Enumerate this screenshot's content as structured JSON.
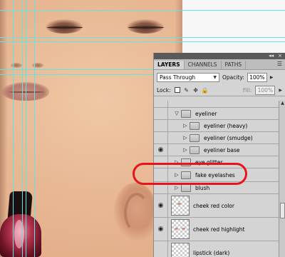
{
  "panel": {
    "topbar_buttons": [
      "◂◂",
      "×"
    ],
    "tabs": [
      {
        "label": "LAYERS",
        "active": true
      },
      {
        "label": "CHANNELS",
        "active": false
      },
      {
        "label": "PATHS",
        "active": false
      }
    ],
    "blend_mode": "Pass Through",
    "opacity_label": "Opacity:",
    "opacity_value": "100%",
    "lock_label": "Lock:",
    "fill_label": "Fill:",
    "fill_value": "100%"
  },
  "layers": [
    {
      "name": "eyeliner",
      "type": "group",
      "expanded": true,
      "indent": 1,
      "visible": false
    },
    {
      "name": "eyeliner (heavy)",
      "type": "group",
      "expanded": false,
      "indent": 2,
      "visible": false
    },
    {
      "name": "eyeliner (smudge)",
      "type": "group",
      "expanded": false,
      "indent": 2,
      "visible": false
    },
    {
      "name": "eyeliner base",
      "type": "group",
      "expanded": false,
      "indent": 2,
      "visible": true
    },
    {
      "name": "eye glitter",
      "type": "group",
      "expanded": false,
      "indent": 1,
      "visible": false
    },
    {
      "name": "fake eyelashes",
      "type": "group",
      "expanded": false,
      "indent": 1,
      "visible": false,
      "highlighted": true
    },
    {
      "name": "blush",
      "type": "group",
      "expanded": false,
      "indent": 1,
      "visible": false
    },
    {
      "name": "cheek red color",
      "type": "pixel",
      "visible": true
    },
    {
      "name": "cheek red highlight",
      "type": "pixel",
      "visible": true
    },
    {
      "name": "lipstick (dark)",
      "type": "pixel",
      "visible": false
    }
  ],
  "colors": {
    "guide": "#5fe6df",
    "annotation": "#e8141c",
    "panel_bg": "#d4d4d4"
  }
}
